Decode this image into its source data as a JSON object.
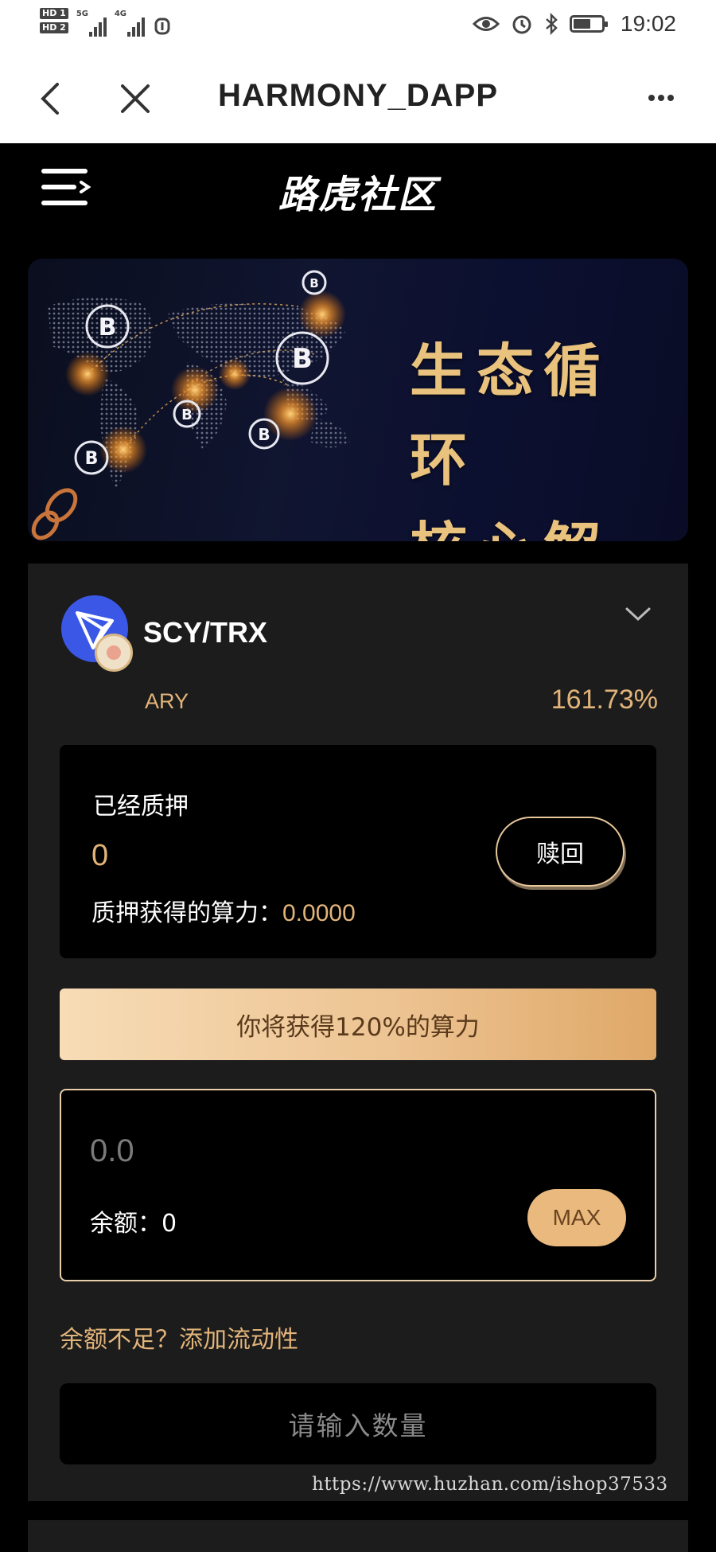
{
  "status_bar": {
    "hd1": "HD 1",
    "hd2": "HD 2",
    "net1": "5G",
    "net2": "4G",
    "time": "19:02"
  },
  "titlebar": {
    "title": "HARMONY_DAPP",
    "back_icon": "chevron-left-icon",
    "close_icon": "close-icon",
    "more_icon": "more-icon"
  },
  "app": {
    "title": "路虎社区",
    "menu_icon": "menu-icon"
  },
  "banner": {
    "line1": "生态循环",
    "line2": "核心解析"
  },
  "pool": {
    "name": "SCY/TRX",
    "apy_label": "ARY",
    "apy_value": "161.73%",
    "staked_label": "已经质押",
    "staked_value": "0",
    "power_label": "质押获得的算力：",
    "power_value": "0.0000",
    "redeem_label": "赎回",
    "gain_text": "你将获得120%的算力",
    "input_placeholder": "0.0",
    "balance_label": "余额：",
    "balance_value": "0",
    "max_label": "MAX",
    "add_liquidity_text": "余额不足？添加流动性",
    "submit_label": "请输入数量"
  },
  "watermark": "https://www.huzhan.com/ishop37533",
  "colors": {
    "accent_gold": "#e2b47a",
    "card_bg": "#1c1c1c",
    "page_bg": "#000000"
  }
}
